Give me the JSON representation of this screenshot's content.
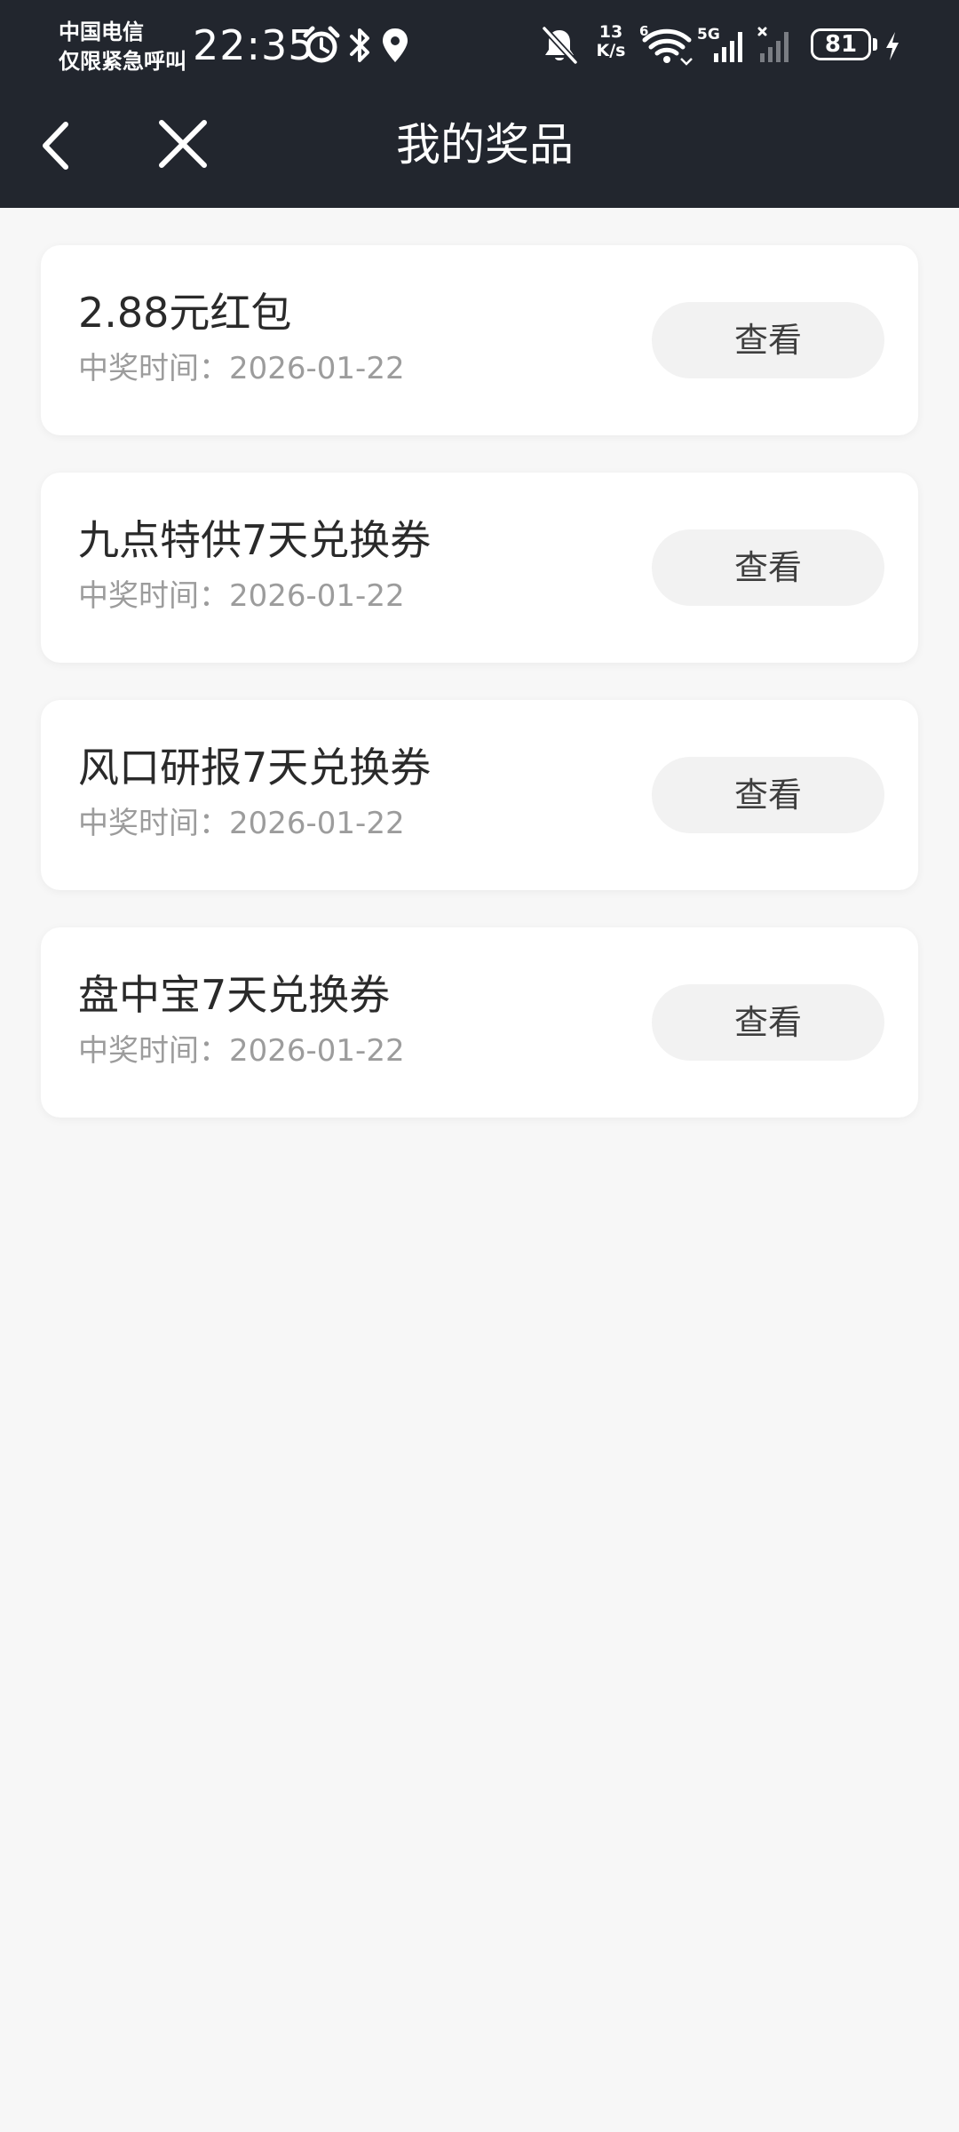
{
  "status_bar": {
    "carrier_line1": "中国电信",
    "carrier_line2": "仅限紧急呼叫",
    "time": "22:35",
    "net_speed_value": "13",
    "net_speed_unit": "K/s",
    "wifi_badge": "6",
    "network_type": "5G",
    "battery_level": "81",
    "icons": [
      "alarm-icon",
      "bluetooth-icon",
      "location-icon",
      "mute-bell-icon",
      "wifi-icon",
      "signal-icon",
      "signal-no-service-icon",
      "battery-icon",
      "charging-icon"
    ]
  },
  "nav": {
    "title": "我的奖品",
    "back_icon": "chevron-left-icon",
    "close_icon": "close-icon"
  },
  "prizes": [
    {
      "name": "2.88元红包",
      "date": "中奖时间：2026-01-22",
      "button_label": "查看"
    },
    {
      "name": "九点特供7天兑换券",
      "date": "中奖时间：2026-01-22",
      "button_label": "查看"
    },
    {
      "name": "风口研报7天兑换券",
      "date": "中奖时间：2026-01-22",
      "button_label": "查看"
    },
    {
      "name": "盘中宝7天兑换券",
      "date": "中奖时间：2026-01-22",
      "button_label": "查看"
    }
  ],
  "colors": {
    "header_background": "#22262e",
    "page_background": "#f7f7f7",
    "card_background": "#ffffff",
    "button_background": "#f2f2f2",
    "secondary_text": "#9c9c9c"
  }
}
